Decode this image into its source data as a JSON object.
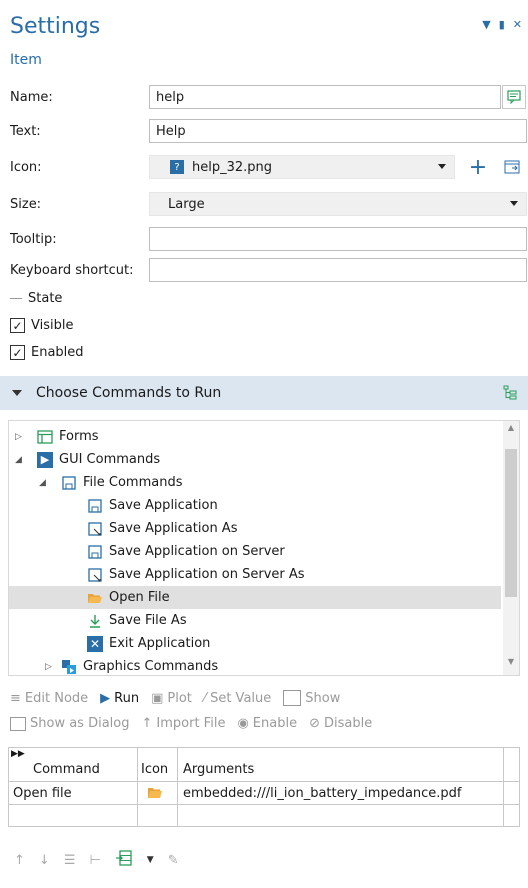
{
  "header": {
    "title": "Settings",
    "subtitle": "Item"
  },
  "window_controls": [
    "chevron-down-icon",
    "pin-icon",
    "close-icon"
  ],
  "form": {
    "name_label": "Name:",
    "name_value": "help",
    "text_label": "Text:",
    "text_value": "Help",
    "icon_label": "Icon:",
    "icon_value": "help_32.png",
    "size_label": "Size:",
    "size_value": "Large",
    "tooltip_label": "Tooltip:",
    "tooltip_value": "",
    "shortcut_label": "Keyboard shortcut:",
    "shortcut_value": ""
  },
  "state": {
    "title": "State",
    "visible_label": "Visible",
    "visible_checked": true,
    "enabled_label": "Enabled",
    "enabled_checked": true
  },
  "commands_section": {
    "title": "Choose Commands to Run"
  },
  "tree": [
    {
      "label": "Forms",
      "depth": 0,
      "expander": "collapsed",
      "icon": "forms-icon"
    },
    {
      "label": "GUI Commands",
      "depth": 0,
      "expander": "expanded",
      "icon": "gui-commands-icon"
    },
    {
      "label": "File Commands",
      "depth": 1,
      "expander": "expanded",
      "icon": "file-commands-icon"
    },
    {
      "label": "Save Application",
      "depth": 2,
      "icon": "save-icon"
    },
    {
      "label": "Save Application As",
      "depth": 2,
      "icon": "save-as-icon"
    },
    {
      "label": "Save Application on Server",
      "depth": 2,
      "icon": "save-icon"
    },
    {
      "label": "Save Application on Server As",
      "depth": 2,
      "icon": "save-as-icon"
    },
    {
      "label": "Open File",
      "depth": 2,
      "icon": "open-folder-icon",
      "selected": true
    },
    {
      "label": "Save File As",
      "depth": 2,
      "icon": "download-arrow-icon"
    },
    {
      "label": "Exit Application",
      "depth": 2,
      "icon": "exit-icon"
    },
    {
      "label": "Graphics Commands",
      "depth": 0,
      "expander": "collapsed",
      "icon": "graphics-commands-icon"
    }
  ],
  "toolbar1": {
    "edit_node": "Edit Node",
    "run": "Run",
    "plot": "Plot",
    "set_value": "Set Value",
    "show": "Show"
  },
  "toolbar2": {
    "show_as_dialog": "Show as Dialog",
    "import_file": "Import File",
    "enable": "Enable",
    "disable": "Disable"
  },
  "table": {
    "headers": [
      "Command",
      "Icon",
      "Arguments"
    ],
    "rows": [
      {
        "command": "Open file",
        "icon": "open-folder-icon",
        "arguments": "embedded:///li_ion_battery_impedance.pdf"
      }
    ]
  },
  "colors": {
    "accent": "#2a6ea8",
    "band": "#dce6f0",
    "selected": "#e0e0e0"
  }
}
